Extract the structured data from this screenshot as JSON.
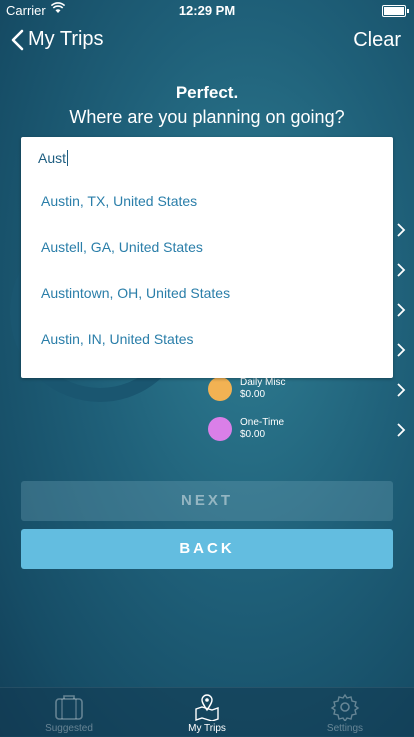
{
  "status_bar": {
    "carrier": "Carrier",
    "time": "12:29 PM"
  },
  "nav": {
    "back_label": "My Trips",
    "clear_label": "Clear"
  },
  "prompt": {
    "line1": "Perfect.",
    "line2": "Where are you planning on going?"
  },
  "search": {
    "query": "Aust",
    "suggestions": [
      "Austin, TX, United States",
      "Austell, GA, United States",
      "Austintown, OH, United States",
      "Austin, IN, United States"
    ]
  },
  "categories": [
    {
      "name": "Daily Misc",
      "amount": "$0.00",
      "color": "#f2b253"
    },
    {
      "name": "One-Time",
      "amount": "$0.00",
      "color": "#da7fe8"
    }
  ],
  "buttons": {
    "next": "NEXT",
    "back": "BACK"
  },
  "tabbar": {
    "tabs": [
      "Suggested",
      "My Trips",
      "Settings"
    ],
    "active": "My Trips"
  }
}
